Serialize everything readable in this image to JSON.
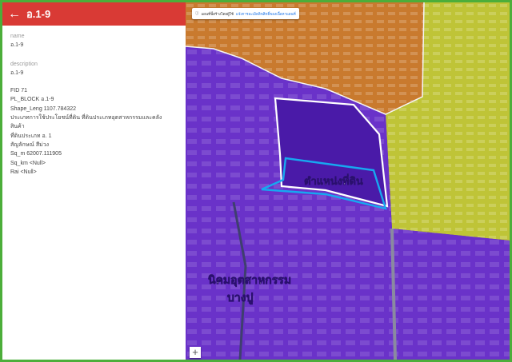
{
  "panel": {
    "title": "อ.1-9",
    "name_label": "name",
    "name_value": "อ.1-9",
    "description_label": "description",
    "description_lines": [
      "อ.1-9",
      "FID 71",
      "PL_BLOCK อ.1-9",
      "Shape_Leng 1107.784322",
      "ประเภทการใช้ประโยชน์ที่ดิน ที่ดินประเภทอุตสาหกรรมและคลัง",
      "สินค้า",
      "ที่ดินประเภท อ. 1",
      "สัญลักษณ์ สีม่วง",
      "Sq_m 62007.111905",
      "Sq_km <Null>",
      "Rai <Null>"
    ]
  },
  "map": {
    "notice_text": "แผนที่นี้สร้างโดยผู้ใช้",
    "notice_link": "แจ้งการละเมิดลิขสิทธิ์ของเนื้อหาแผนที่",
    "land_label": "ตำแหน่งที่ดิน",
    "estate_label_1": "นิคมอุตสาหกรรม",
    "estate_label_2": "บางปู",
    "zoom_in": "+"
  },
  "colors": {
    "header": "#d93a35",
    "frame": "#4cae3a",
    "industrial_zone": "#6a2fd0",
    "orange_zone": "#e08a2c",
    "yellow_zone": "#cfd12a",
    "outline_blue": "#17a8f0"
  }
}
